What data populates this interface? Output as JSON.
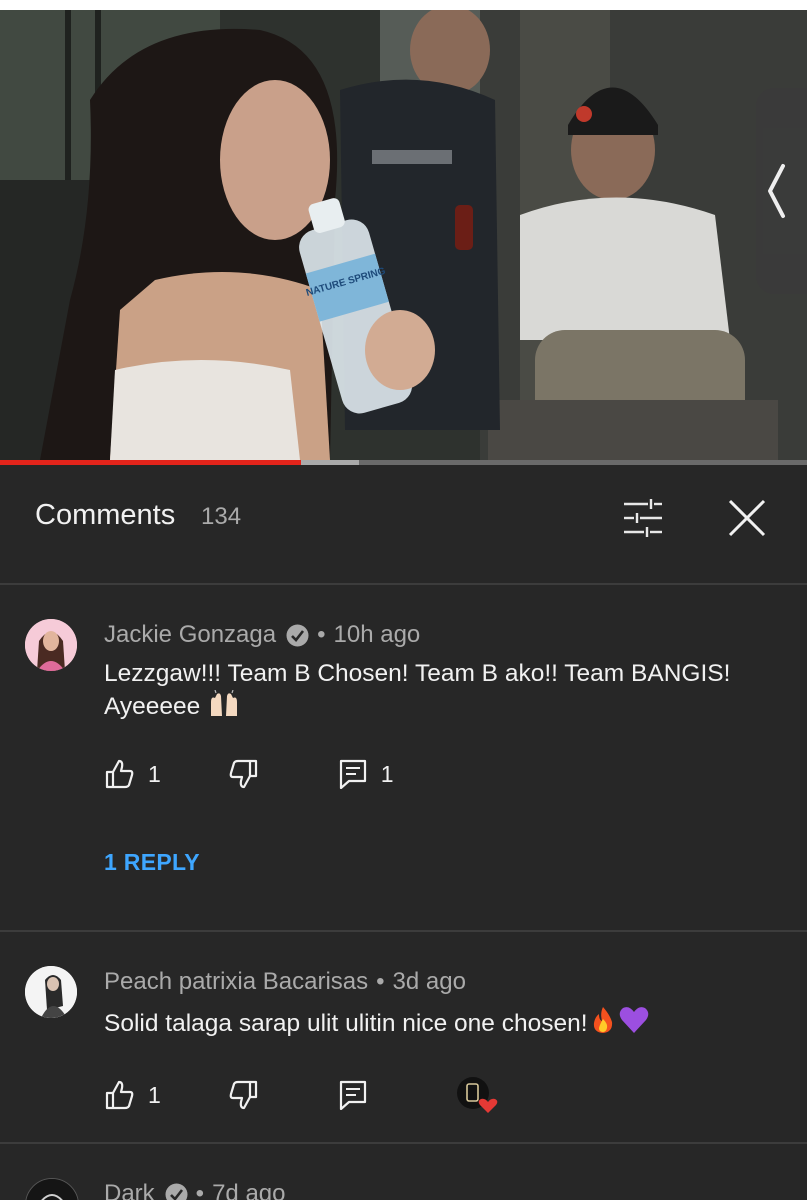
{
  "video": {
    "progress_fraction": 0.373,
    "buffered_fraction": 0.445,
    "bottle_label": "NATURE SPRING"
  },
  "colors": {
    "background": "#272727",
    "accent_red": "#e3241b",
    "link_blue": "#3ea6ff",
    "heart_red": "#e53935"
  },
  "side_handle": {
    "icon": "chevron-left-icon"
  },
  "header": {
    "title": "Comments",
    "count": "134",
    "sort_icon": "sliders-icon",
    "close_icon": "close-icon"
  },
  "comments": [
    {
      "author": "Jackie Gonzaga",
      "verified": true,
      "time": "10h ago",
      "text": "Lezzgaw!!! Team B Chosen! Team B ako!! Team BANGIS! Ayeeeee",
      "emoji": "raised-hands",
      "likes": "1",
      "replies_count": "1",
      "reply_link": "1 REPLY"
    },
    {
      "author": "Peach patrixia Bacarisas",
      "verified": false,
      "time": "3d ago",
      "text": "Solid talaga sarap ulit ulitin nice one chosen!",
      "emoji": "fire-purple-heart",
      "likes": "1",
      "creator_hearted": true
    },
    {
      "author": "Dark",
      "verified": true,
      "time": "7d ago"
    }
  ],
  "dot_separator": "•"
}
